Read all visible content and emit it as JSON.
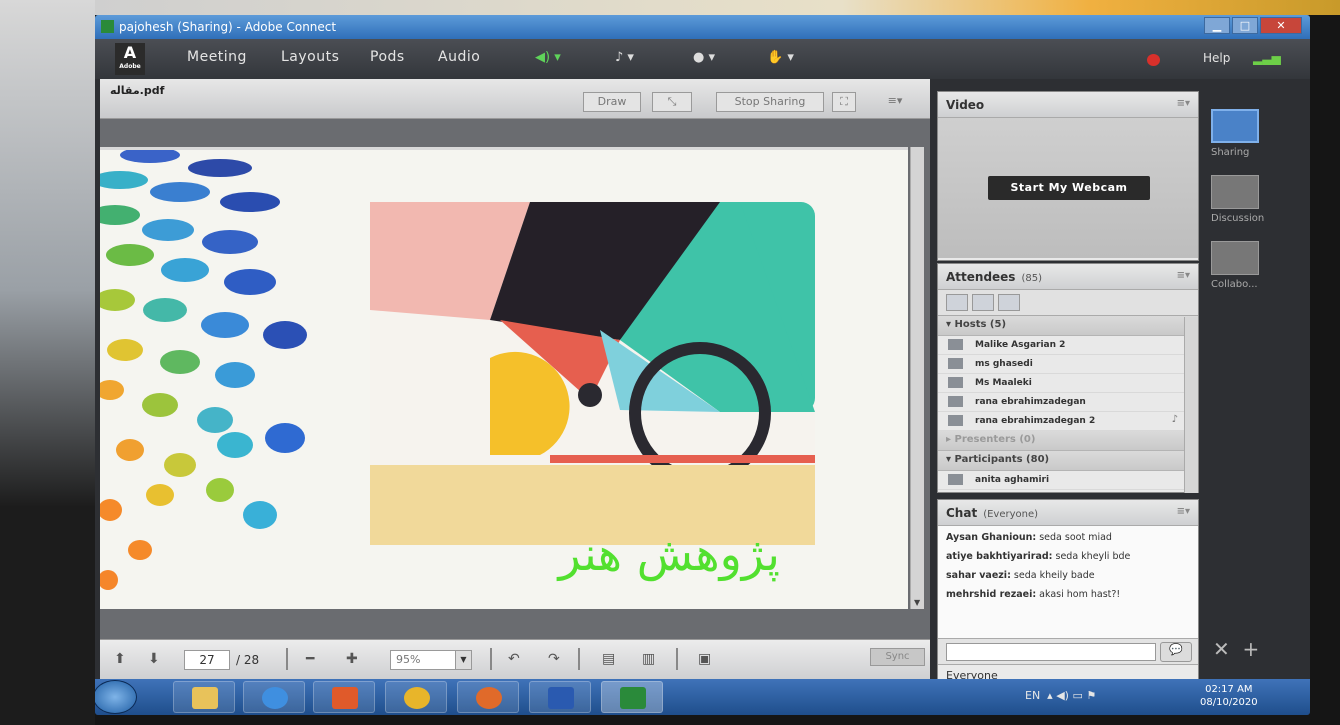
{
  "window": {
    "title": "pajohesh (Sharing) - Adobe Connect",
    "min": "▁",
    "max": "□",
    "close": "✕"
  },
  "menubar": {
    "logo": "A",
    "logo_sub": "Adobe",
    "items": [
      "Meeting",
      "Layouts",
      "Pods",
      "Audio"
    ],
    "help": "Help"
  },
  "share": {
    "filename": "مقاله.pdf",
    "draw_label": "Draw",
    "stop_sharing_label": "Stop Sharing",
    "slide_text": "پژوهش هنر",
    "page_current": "27",
    "page_total": "/ 28",
    "zoom": "95%",
    "sync_label": "Sync"
  },
  "video": {
    "title": "Video",
    "webcam_button": "Start My Webcam"
  },
  "attendees": {
    "title": "Attendees",
    "count": "(85)",
    "hosts_label": "Hosts (5)",
    "hosts": [
      "Malike Asgarian 2",
      "ms ghasedi",
      "Ms Maaleki",
      "rana ebrahimzadegan",
      "rana ebrahimzadegan 2"
    ],
    "presenters_label": "Presenters (0)",
    "participants_label": "Participants (80)",
    "participants": [
      "anita aghamiri"
    ]
  },
  "chat": {
    "title": "Chat",
    "scope": "(Everyone)",
    "messages": [
      {
        "name": "Aysan Ghanioun:",
        "text": "seda soot miad"
      },
      {
        "name": "atiye bakhtiyarirad:",
        "text": "seda kheyli bde"
      },
      {
        "name": "sahar vaezi:",
        "text": "seda kheily bade"
      },
      {
        "name": "mehrshid rezaei:",
        "text": "akasi hom hast?!"
      }
    ],
    "footer": "Everyone"
  },
  "layouts": [
    {
      "label": "Sharing",
      "active": true
    },
    {
      "label": "Discussion",
      "active": false
    },
    {
      "label": "Collabo...",
      "active": false
    }
  ],
  "taskbar": {
    "lang": "EN",
    "time": "02:17 AM",
    "date": "08/10/2020"
  },
  "colors": {
    "slide_text": "#52e02f",
    "accent_blue": "#2f6fb9",
    "record_red": "#d8302b"
  }
}
